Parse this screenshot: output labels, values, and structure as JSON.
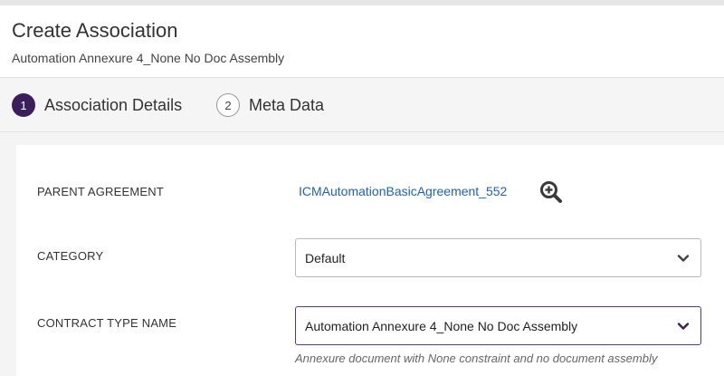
{
  "header": {
    "title": "Create Association",
    "subtitle": "Automation Annexure 4_None No Doc Assembly"
  },
  "steps": [
    {
      "number": "1",
      "label": "Association Details",
      "active": true
    },
    {
      "number": "2",
      "label": "Meta Data",
      "active": false
    }
  ],
  "form": {
    "parent_agreement": {
      "label": "PARENT AGREEMENT",
      "value": "ICMAutomationBasicAgreement_552",
      "icon": "zoom-in-icon"
    },
    "category": {
      "label": "CATEGORY",
      "value": "Default"
    },
    "contract_type": {
      "label": "CONTRACT TYPE NAME",
      "value": "Automation Annexure 4_None No Doc Assembly",
      "hint": "Annexure document with None constraint and no document assembly"
    }
  },
  "colors": {
    "accent": "#3b1f5c",
    "link": "#1f63b5",
    "focus_border": "#5b3b85"
  }
}
